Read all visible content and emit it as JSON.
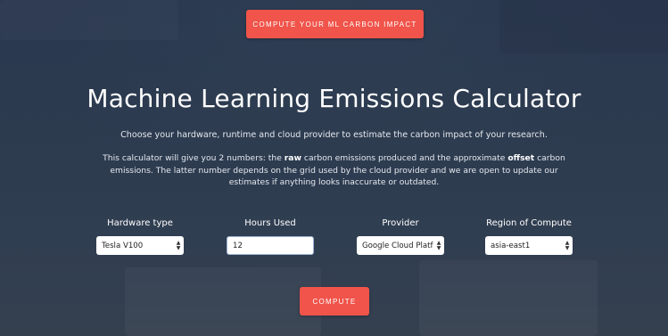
{
  "header": {
    "cta_label": "COMPUTE YOUR ML CARBON IMPACT"
  },
  "hero": {
    "title": "Machine Learning Emissions Calculator",
    "subtitle": "Choose your hardware, runtime and cloud provider to estimate the carbon impact of your research.",
    "description": {
      "part1": "This calculator will give you 2 numbers: the ",
      "raw": "raw",
      "part2": " carbon emissions produced and the approximate ",
      "offset": "offset",
      "part3": " carbon emissions. The latter number depends on the grid used by the cloud provider and we are open to update our estimates if anything looks inaccurate or outdated."
    }
  },
  "form": {
    "hardware": {
      "label": "Hardware type",
      "value": "Tesla V100"
    },
    "hours": {
      "label": "Hours Used",
      "value": "12"
    },
    "provider": {
      "label": "Provider",
      "value": "Google Cloud Platform"
    },
    "region": {
      "label": "Region of Compute",
      "value": "asia-east1"
    },
    "submit_label": "COMPUTE"
  },
  "icons": {
    "select_arrows": "up-down-arrows-icon"
  },
  "colors": {
    "accent": "#f0544a",
    "background": "#2c3a4e",
    "text": "#ffffff"
  }
}
